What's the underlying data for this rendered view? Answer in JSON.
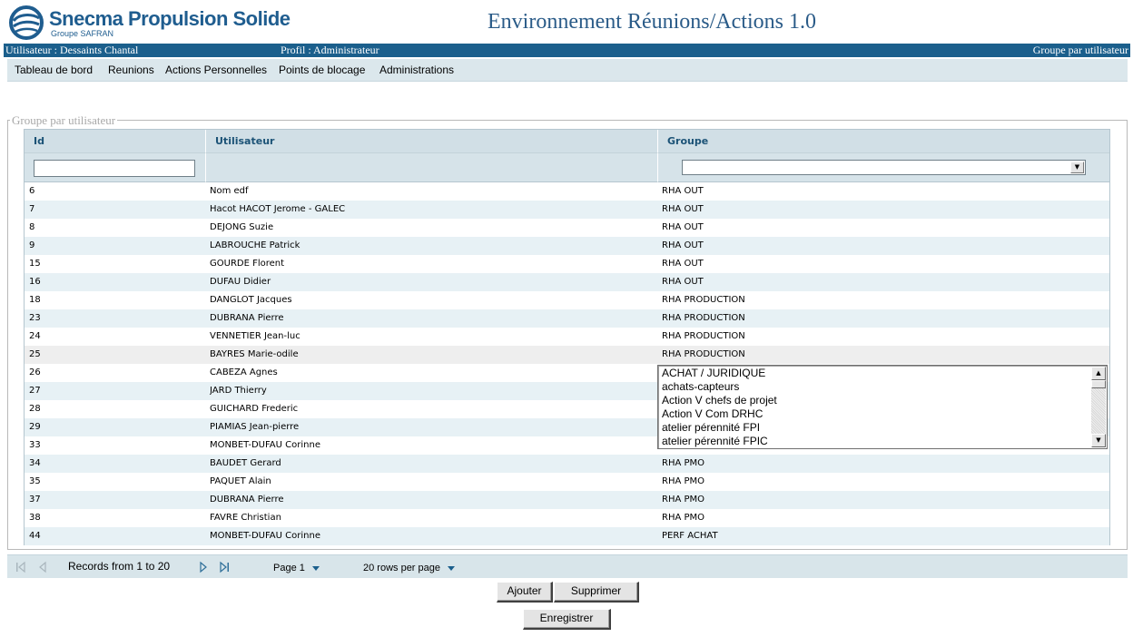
{
  "brand": {
    "name": "Snecma Propulsion Solide",
    "subtitle": "Groupe SAFRAN",
    "color": "#1f5d8f"
  },
  "app_title": "Environnement Réunions/Actions 1.0",
  "userbar": {
    "user": "Utilisateur : Dessaints Chantal",
    "profile": "Profil : Administrateur",
    "page": "Groupe par utilisateur",
    "color": "#1b5f8c"
  },
  "menu": [
    "Tableau de bord",
    "Reunions",
    "Actions Personnelles",
    "Points de blocage",
    "Administrations"
  ],
  "fieldset_legend": "Groupe par utilisateur",
  "grid": {
    "columns": [
      "Id",
      "Utilisateur",
      "Groupe"
    ],
    "filters": {
      "id_value": "",
      "groupe_value": ""
    },
    "rows": [
      {
        "id": "6",
        "user": "Nom edf",
        "group": "RHA OUT"
      },
      {
        "id": "7",
        "user": "Hacot HACOT Jerome - GALEC",
        "group": "RHA OUT"
      },
      {
        "id": "8",
        "user": "DEJONG Suzie",
        "group": "RHA OUT"
      },
      {
        "id": "9",
        "user": "LABROUCHE Patrick",
        "group": "RHA OUT"
      },
      {
        "id": "15",
        "user": "GOURDE Florent",
        "group": "RHA OUT"
      },
      {
        "id": "16",
        "user": "DUFAU Didier",
        "group": "RHA OUT"
      },
      {
        "id": "18",
        "user": "DANGLOT Jacques",
        "group": "RHA PRODUCTION"
      },
      {
        "id": "23",
        "user": "DUBRANA Pierre",
        "group": "RHA PRODUCTION"
      },
      {
        "id": "24",
        "user": "VENNETIER Jean-luc",
        "group": "RHA PRODUCTION"
      },
      {
        "id": "25",
        "user": "BAYRES Marie-odile",
        "group": "RHA PRODUCTION"
      },
      {
        "id": "26",
        "user": "CABEZA Agnes",
        "group": ""
      },
      {
        "id": "27",
        "user": "JARD Thierry",
        "group": ""
      },
      {
        "id": "28",
        "user": "GUICHARD Frederic",
        "group": ""
      },
      {
        "id": "29",
        "user": "PIAMIAS Jean-pierre",
        "group": ""
      },
      {
        "id": "33",
        "user": "MONBET-DUFAU Corinne",
        "group": ""
      },
      {
        "id": "34",
        "user": "BAUDET Gerard",
        "group": "RHA PMO"
      },
      {
        "id": "35",
        "user": "PAQUET Alain",
        "group": "RHA PMO"
      },
      {
        "id": "37",
        "user": "DUBRANA Pierre",
        "group": "RHA PMO"
      },
      {
        "id": "38",
        "user": "FAVRE Christian",
        "group": "RHA PMO"
      },
      {
        "id": "44",
        "user": "MONBET-DUFAU Corinne",
        "group": "PERF ACHAT"
      }
    ],
    "group_dropdown_options": [
      "ACHAT / JURIDIQUE",
      "achats-capteurs",
      "Action V chefs de projet",
      "Action V Com DRHC",
      "atelier pérennité FPI",
      "atelier pérennité FPIC"
    ]
  },
  "pager": {
    "records": "Records from 1 to 20",
    "page": "Page 1",
    "rows_per_page": "20 rows per page",
    "icons": [
      "first-page-icon",
      "prev-page-icon",
      "next-page-icon",
      "last-page-icon"
    ]
  },
  "buttons": {
    "add": "Ajouter",
    "delete": "Supprimer",
    "save": "Enregistrer"
  }
}
